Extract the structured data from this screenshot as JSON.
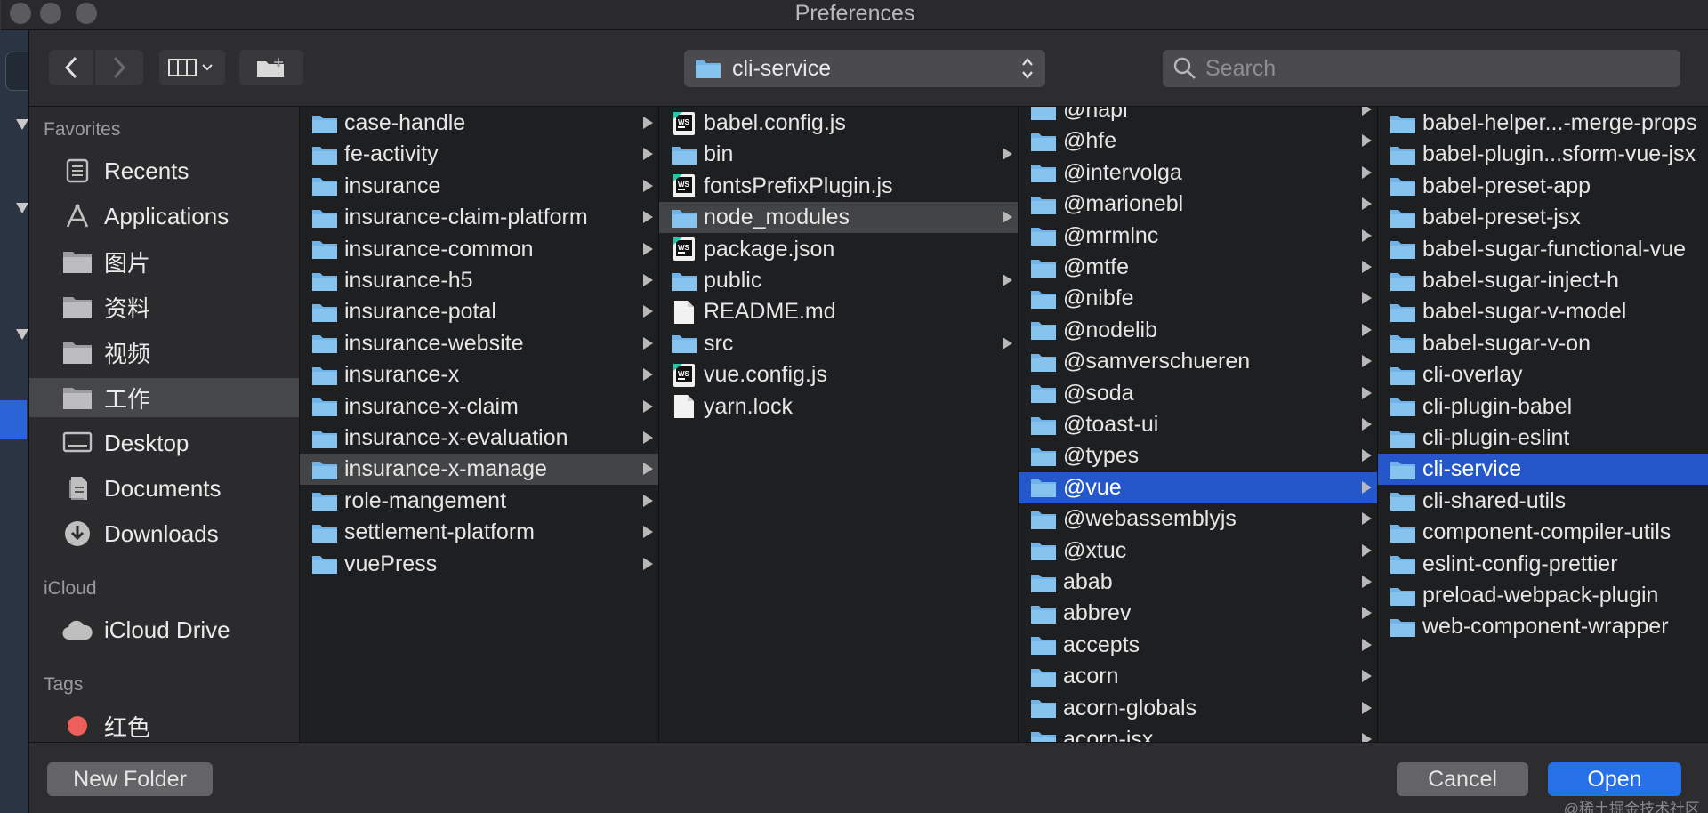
{
  "window": {
    "title": "Preferences"
  },
  "toolbar": {
    "back_icon": "chevron-left-icon",
    "forward_icon": "chevron-right-icon",
    "view_icon": "column-view-icon",
    "new_folder_icon": "new-folder-icon",
    "path_popup": {
      "value": "cli-service"
    },
    "search": {
      "placeholder": "Search",
      "value": ""
    }
  },
  "sidebar": {
    "favorites_label": "Favorites",
    "favorites": [
      {
        "label": "Recents",
        "icon": "clock-icon"
      },
      {
        "label": "Applications",
        "icon": "applications-icon"
      },
      {
        "label": "图片",
        "icon": "folder-icon"
      },
      {
        "label": "资料",
        "icon": "folder-icon"
      },
      {
        "label": "视频",
        "icon": "folder-icon"
      },
      {
        "label": "工作",
        "icon": "folder-icon",
        "selected": true
      },
      {
        "label": "Desktop",
        "icon": "desktop-icon"
      },
      {
        "label": "Documents",
        "icon": "documents-icon"
      },
      {
        "label": "Downloads",
        "icon": "downloads-icon"
      }
    ],
    "icloud_label": "iCloud",
    "icloud": [
      {
        "label": "iCloud Drive",
        "icon": "cloud-icon"
      }
    ],
    "tags_label": "Tags",
    "tags": [
      {
        "label": "红色",
        "color": "#ec5f5a"
      }
    ]
  },
  "columns": [
    {
      "items": [
        {
          "label": "case-handle",
          "kind": "folder",
          "chevron": true
        },
        {
          "label": "fe-activity",
          "kind": "folder",
          "chevron": true
        },
        {
          "label": "insurance",
          "kind": "folder",
          "chevron": true
        },
        {
          "label": "insurance-claim-platform",
          "kind": "folder",
          "chevron": true
        },
        {
          "label": "insurance-common",
          "kind": "folder",
          "chevron": true
        },
        {
          "label": "insurance-h5",
          "kind": "folder",
          "chevron": true
        },
        {
          "label": "insurance-potal",
          "kind": "folder",
          "chevron": true
        },
        {
          "label": "insurance-website",
          "kind": "folder",
          "chevron": true
        },
        {
          "label": "insurance-x",
          "kind": "folder",
          "chevron": true
        },
        {
          "label": "insurance-x-claim",
          "kind": "folder",
          "chevron": true
        },
        {
          "label": "insurance-x-evaluation",
          "kind": "folder",
          "chevron": true
        },
        {
          "label": "insurance-x-manage",
          "kind": "folder",
          "chevron": true,
          "state": "highlighted"
        },
        {
          "label": "role-mangement",
          "kind": "folder",
          "chevron": true
        },
        {
          "label": "settlement-platform",
          "kind": "folder",
          "chevron": true
        },
        {
          "label": "vuePress",
          "kind": "folder",
          "chevron": true
        }
      ]
    },
    {
      "items": [
        {
          "label": "babel.config.js",
          "kind": "ws"
        },
        {
          "label": "bin",
          "kind": "folder",
          "chevron": true
        },
        {
          "label": "fontsPrefixPlugin.js",
          "kind": "ws"
        },
        {
          "label": "node_modules",
          "kind": "folder",
          "chevron": true,
          "state": "highlighted"
        },
        {
          "label": "package.json",
          "kind": "ws"
        },
        {
          "label": "public",
          "kind": "folder",
          "chevron": true
        },
        {
          "label": "README.md",
          "kind": "file"
        },
        {
          "label": "src",
          "kind": "folder",
          "chevron": true
        },
        {
          "label": "vue.config.js",
          "kind": "ws"
        },
        {
          "label": "yarn.lock",
          "kind": "file"
        }
      ]
    },
    {
      "items": [
        {
          "label": "@hapi",
          "kind": "folder",
          "chevron": true
        },
        {
          "label": "@hfe",
          "kind": "folder",
          "chevron": true
        },
        {
          "label": "@intervolga",
          "kind": "folder",
          "chevron": true
        },
        {
          "label": "@marionebl",
          "kind": "folder",
          "chevron": true
        },
        {
          "label": "@mrmlnc",
          "kind": "folder",
          "chevron": true
        },
        {
          "label": "@mtfe",
          "kind": "folder",
          "chevron": true
        },
        {
          "label": "@nibfe",
          "kind": "folder",
          "chevron": true
        },
        {
          "label": "@nodelib",
          "kind": "folder",
          "chevron": true
        },
        {
          "label": "@samverschueren",
          "kind": "folder",
          "chevron": true
        },
        {
          "label": "@soda",
          "kind": "folder",
          "chevron": true
        },
        {
          "label": "@toast-ui",
          "kind": "folder",
          "chevron": true
        },
        {
          "label": "@types",
          "kind": "folder",
          "chevron": true
        },
        {
          "label": "@vue",
          "kind": "folder",
          "chevron": true,
          "state": "selected"
        },
        {
          "label": "@webassemblyjs",
          "kind": "folder",
          "chevron": true
        },
        {
          "label": "@xtuc",
          "kind": "folder",
          "chevron": true
        },
        {
          "label": "abab",
          "kind": "folder",
          "chevron": true
        },
        {
          "label": "abbrev",
          "kind": "folder",
          "chevron": true
        },
        {
          "label": "accepts",
          "kind": "folder",
          "chevron": true
        },
        {
          "label": "acorn",
          "kind": "folder",
          "chevron": true
        },
        {
          "label": "acorn-globals",
          "kind": "folder",
          "chevron": true
        },
        {
          "label": "acorn-jsx",
          "kind": "folder",
          "chevron": true
        }
      ]
    },
    {
      "items": [
        {
          "label": "babel-helper...-merge-props",
          "kind": "folder"
        },
        {
          "label": "babel-plugin...sform-vue-jsx",
          "kind": "folder"
        },
        {
          "label": "babel-preset-app",
          "kind": "folder"
        },
        {
          "label": "babel-preset-jsx",
          "kind": "folder"
        },
        {
          "label": "babel-sugar-functional-vue",
          "kind": "folder"
        },
        {
          "label": "babel-sugar-inject-h",
          "kind": "folder"
        },
        {
          "label": "babel-sugar-v-model",
          "kind": "folder"
        },
        {
          "label": "babel-sugar-v-on",
          "kind": "folder"
        },
        {
          "label": "cli-overlay",
          "kind": "folder"
        },
        {
          "label": "cli-plugin-babel",
          "kind": "folder"
        },
        {
          "label": "cli-plugin-eslint",
          "kind": "folder"
        },
        {
          "label": "cli-service",
          "kind": "folder",
          "state": "selected"
        },
        {
          "label": "cli-shared-utils",
          "kind": "folder"
        },
        {
          "label": "component-compiler-utils",
          "kind": "folder"
        },
        {
          "label": "eslint-config-prettier",
          "kind": "folder"
        },
        {
          "label": "preload-webpack-plugin",
          "kind": "folder"
        },
        {
          "label": "web-component-wrapper",
          "kind": "folder"
        }
      ]
    }
  ],
  "footer": {
    "new_folder_label": "New Folder",
    "cancel_label": "Cancel",
    "open_label": "Open",
    "watermark": "@稀土掘金技术社区"
  },
  "colors": {
    "selection_blue": "#2457c9",
    "highlight_grey": "#434446",
    "folder_blue": "#6fb3e8",
    "open_button": "#2670e8"
  }
}
